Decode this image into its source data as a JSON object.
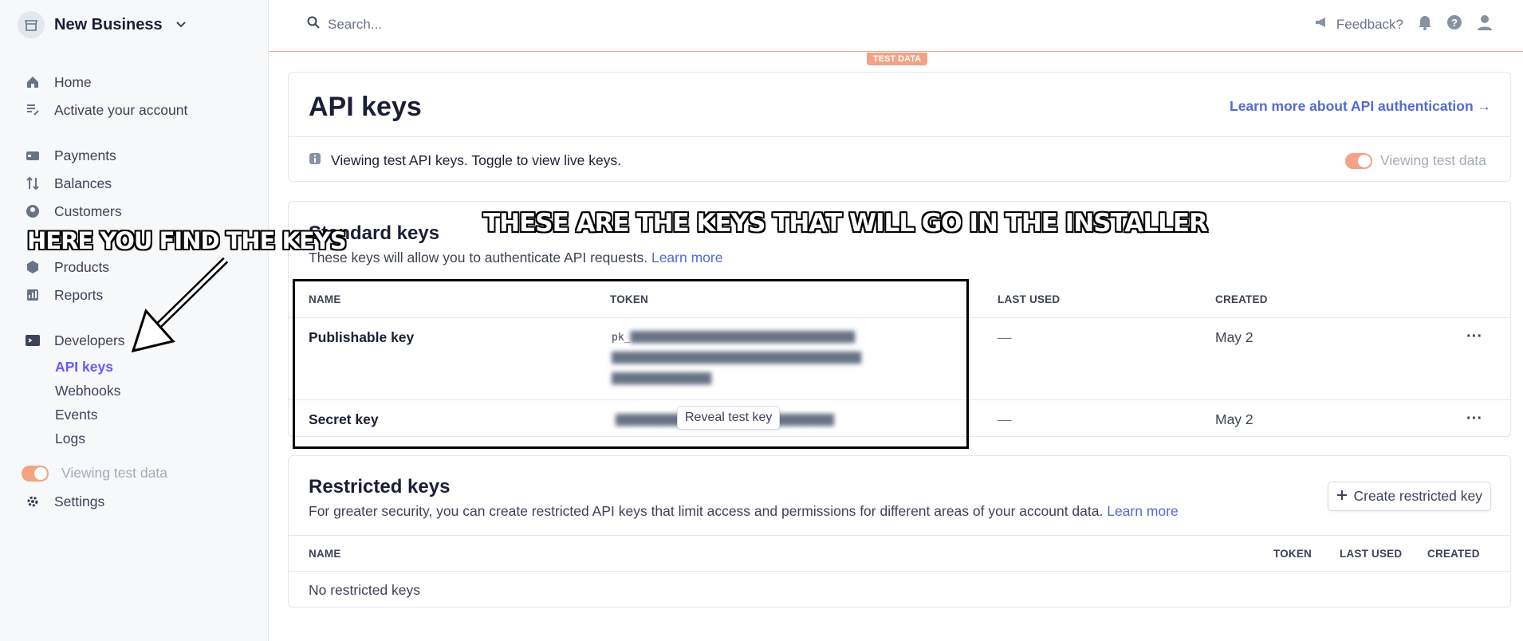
{
  "sidebar": {
    "business_name": "New Business",
    "primary": [
      {
        "label": "Home",
        "icon": "home-icon"
      },
      {
        "label": "Activate your account",
        "icon": "checklist-icon"
      }
    ],
    "main": [
      {
        "label": "Payments",
        "icon": "payments-icon"
      },
      {
        "label": "Balances",
        "icon": "balances-icon"
      },
      {
        "label": "Customers",
        "icon": "customers-icon"
      },
      {
        "label": "Products",
        "icon": "products-icon"
      },
      {
        "label": "Reports",
        "icon": "reports-icon"
      }
    ],
    "developers": {
      "label": "Developers",
      "items": [
        "API keys",
        "Webhooks",
        "Events",
        "Logs"
      ],
      "active": "API keys"
    },
    "test_toggle_label": "Viewing test data",
    "settings_label": "Settings"
  },
  "topbar": {
    "search_placeholder": "Search...",
    "feedback_label": "Feedback?",
    "test_data_badge": "TEST DATA"
  },
  "api_header": {
    "title": "API keys",
    "learn_link": "Learn more about API authentication →",
    "notice": "Viewing test API keys. Toggle to view live keys.",
    "toggle_label": "Viewing test data"
  },
  "standard_keys": {
    "title": "Standard keys",
    "description": "These keys will allow you to authenticate API requests.",
    "learn_more": "Learn more",
    "columns": [
      "NAME",
      "TOKEN",
      "LAST USED",
      "CREATED"
    ],
    "rows": [
      {
        "name": "Publishable key",
        "token_prefix": "pk_",
        "last_used": "—",
        "created": "May 2"
      },
      {
        "name": "Secret key",
        "reveal_button": "Reveal test key",
        "last_used": "—",
        "created": "May 2"
      }
    ]
  },
  "restricted_keys": {
    "title": "Restricted keys",
    "description": "For greater security, you can create restricted API keys that limit access and permissions for different areas of your account data.",
    "learn_more": "Learn more",
    "create_button": "Create restricted key",
    "columns": [
      "NAME",
      "TOKEN",
      "LAST USED",
      "CREATED"
    ],
    "empty": "No restricted keys"
  },
  "annotations": {
    "left": "HERE YOU FIND THE KEYS",
    "center": "THESE ARE THE KEYS THAT WILL GO IN THE INSTALLER"
  },
  "colors": {
    "accent": "#635bff",
    "link": "#5469d4",
    "test_orange": "#f3a284"
  }
}
